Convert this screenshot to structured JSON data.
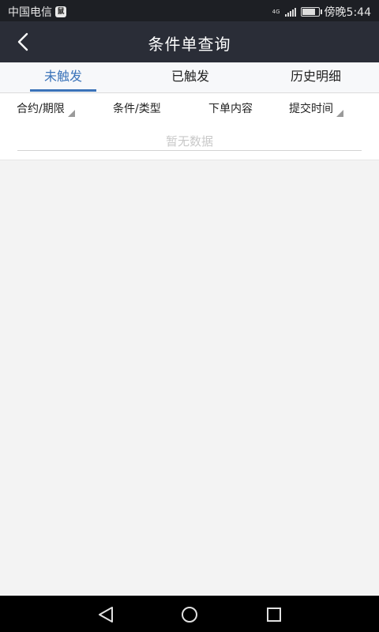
{
  "status_bar": {
    "carrier": "中国电信",
    "carrier_icon_text": "鼠",
    "network_type": "4G",
    "time": "傍晚5:44",
    "battery_level": 0.85
  },
  "header": {
    "title": "条件单查询",
    "back_icon": "chevron-left-icon"
  },
  "tabs": [
    {
      "label": "未触发",
      "active": true
    },
    {
      "label": "已触发",
      "active": false
    },
    {
      "label": "历史明细",
      "active": false
    }
  ],
  "columns": [
    {
      "label": "合约/期限",
      "sortable": true
    },
    {
      "label": "条件/类型",
      "sortable": false
    },
    {
      "label": "下单内容",
      "sortable": false
    },
    {
      "label": "提交时间",
      "sortable": true
    }
  ],
  "empty_state": {
    "text": "暂无数据"
  },
  "nav_bar": {
    "back_icon": "triangle-back-icon",
    "home_icon": "circle-home-icon",
    "recents_icon": "square-recents-icon"
  },
  "colors": {
    "accent": "#3b73b9",
    "header_bg": "#2a2d37",
    "page_bg": "#f3f3f3"
  }
}
